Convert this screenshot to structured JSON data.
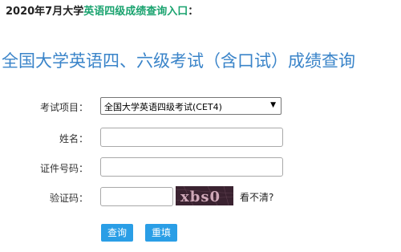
{
  "headline": {
    "prefix": "2020年7月大学",
    "link_text": "英语四级成绩查询入口",
    "suffix": "："
  },
  "page_title": "全国大学英语四、六级考试（含口试）成绩查询",
  "form": {
    "exam_item": {
      "label": "考试项目：",
      "selected": "全国大学英语四级考试(CET4)"
    },
    "name": {
      "label": "姓名：",
      "value": ""
    },
    "id_number": {
      "label": "证件号码：",
      "value": ""
    },
    "captcha": {
      "label": "验证码：",
      "value": "",
      "image_text": "xbs0",
      "refresh_text": "看不清?"
    }
  },
  "buttons": {
    "query_label": "查询",
    "reset_label": "重填"
  },
  "colors": {
    "title_blue": "#3a84c9",
    "link_green": "#1aa36f",
    "button_blue": "#2a9ee6"
  }
}
